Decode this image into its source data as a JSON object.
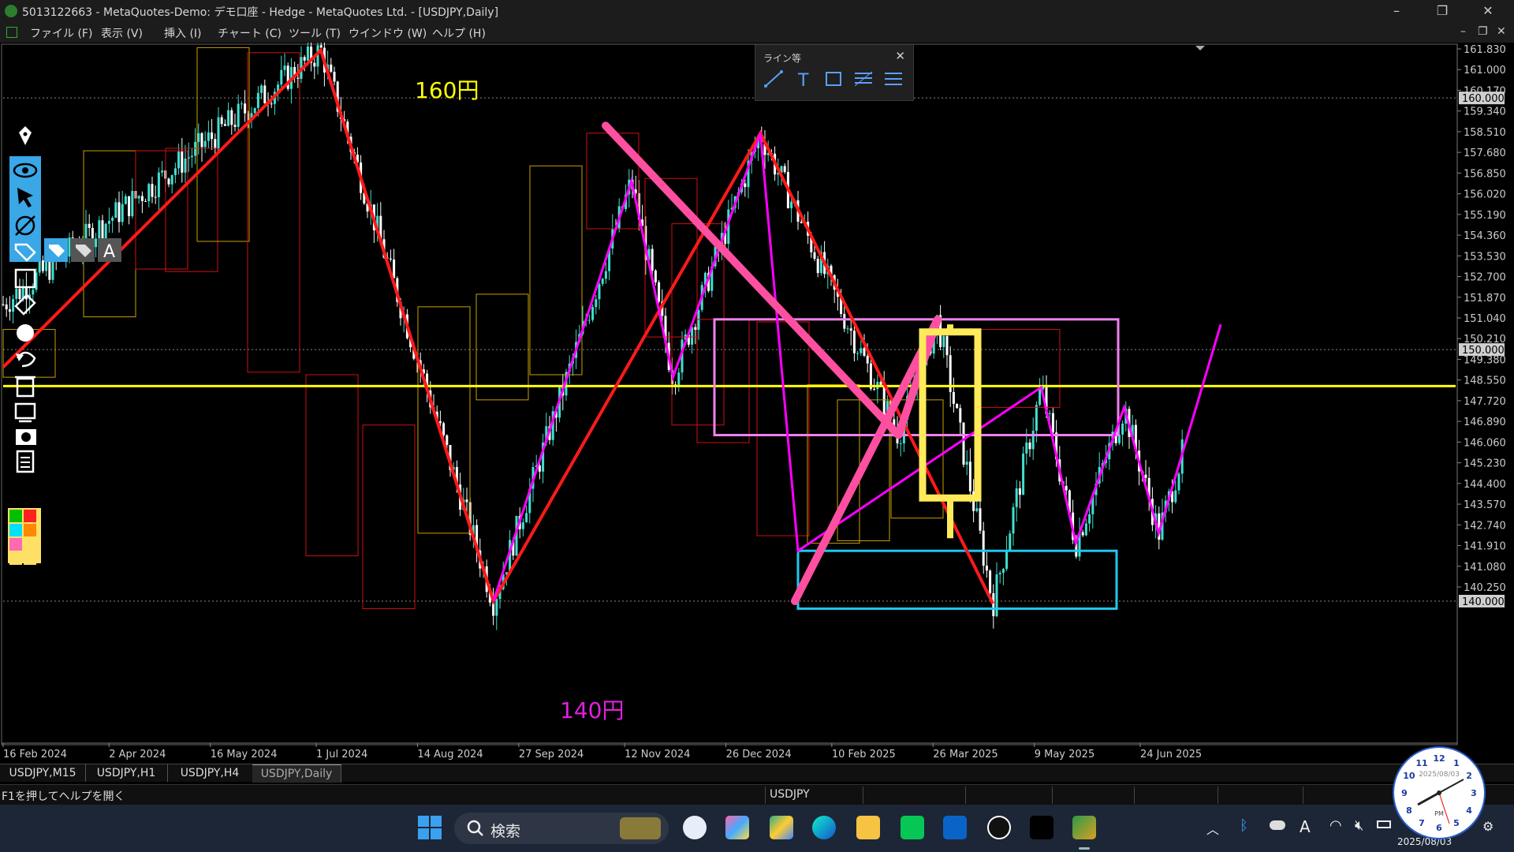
{
  "window": {
    "title": "5013122663 - MetaQuotes-Demo: デモ口座 - Hedge - MetaQuotes Ltd. - [USDJPY,Daily]",
    "controls": [
      "–",
      "❐",
      "✕"
    ]
  },
  "menu": {
    "items": [
      "ファイル (F)",
      "表示 (V)",
      "挿入 (I)",
      "チャート (C)",
      "ツール (T)",
      "ウインドウ (W)",
      "ヘルプ (H)"
    ]
  },
  "line_toolbar": {
    "title": "ライン等",
    "close": "✕",
    "tools": [
      "trendline-icon",
      "text-icon",
      "rectangle-icon",
      "fibonacci-icon",
      "channel-icon"
    ]
  },
  "left_tools": [
    "pen-icon",
    "eye-icon",
    "cursor-icon",
    "eraser-icon",
    "tag-icon",
    "square-icon",
    "ruler-icon",
    "dot-icon",
    "undo-icon",
    "trash-icon",
    "monitor-icon",
    "camera-icon",
    "notes-icon"
  ],
  "left_tools_sub": {
    "text_tool": "A"
  },
  "palette": [
    "#00c000",
    "#ff2020",
    "#00e0ff",
    "#ff8800",
    "#ff69b4",
    "#ffe066"
  ],
  "chart": {
    "symbol": "USDJPY",
    "timeframe": "Daily",
    "annotations": {
      "top_label": "160円",
      "bottom_label": "140円"
    },
    "colors": {
      "background": "#000000",
      "up_candle": "#40e0d0",
      "down_candle": "#ffffff",
      "h_line": "#ffff00",
      "zigzag_red": "#ff1a1a",
      "zigzag_magenta": "#ff00ff",
      "pink_line": "#ff4fa0",
      "yellow_box": "#ffeb5a",
      "blue_box": "#1ec8f0",
      "violet_box": "#ee82ee"
    },
    "price_ticks": [
      "161.830",
      "161.000",
      "160.170",
      "159.340",
      "158.510",
      "157.680",
      "156.850",
      "156.020",
      "155.190",
      "154.360",
      "153.530",
      "152.700",
      "151.870",
      "151.040",
      "150.210",
      "149.380",
      "148.550",
      "147.720",
      "146.890",
      "146.060",
      "145.230",
      "144.400",
      "143.570",
      "142.740",
      "141.910",
      "141.080",
      "140.250"
    ],
    "price_ticks_range": [
      140.25,
      161.83
    ],
    "highlight_labels": [
      "160.000",
      "150.000",
      "140.000"
    ],
    "date_ticks": [
      "16 Feb 2024",
      "2 Apr 2024",
      "16 May 2024",
      "1 Jul 2024",
      "14 Aug 2024",
      "27 Sep 2024",
      "12 Nov 2024",
      "26 Dec 2024",
      "10 Feb 2025",
      "26 Mar 2025",
      "9 May 2025",
      "24 Jun 2025"
    ]
  },
  "chart_data": {
    "type": "candlestick",
    "symbol": "USDJPY",
    "timeframe": "Daily",
    "x": [
      "2024-02-16",
      "2024-04-02",
      "2024-05-16",
      "2024-07-01",
      "2024-08-14",
      "2024-09-27",
      "2024-11-12",
      "2024-12-26",
      "2025-02-10",
      "2025-03-26",
      "2025-05-09",
      "2025-06-24"
    ],
    "y_range": [
      140.0,
      162.2
    ],
    "horizontal_lines": [
      160.0,
      150.0,
      148.55,
      140.0
    ],
    "swing_points": [
      {
        "date": "2024-02-16",
        "price": 151.8
      },
      {
        "date": "2024-07-03",
        "price": 161.9
      },
      {
        "date": "2024-09-16",
        "price": 140.0
      },
      {
        "date": "2024-11-15",
        "price": 156.7
      },
      {
        "date": "2024-12-03",
        "price": 148.9
      },
      {
        "date": "2025-01-10",
        "price": 158.6
      },
      {
        "date": "2025-03-11",
        "price": 146.6
      },
      {
        "date": "2025-03-28",
        "price": 151.2
      },
      {
        "date": "2025-04-21",
        "price": 139.9
      },
      {
        "date": "2025-05-12",
        "price": 148.5
      },
      {
        "date": "2025-05-27",
        "price": 142.3
      },
      {
        "date": "2025-06-17",
        "price": 147.7
      },
      {
        "date": "2025-07-02",
        "price": 142.7
      },
      {
        "date": "2025-07-29",
        "price": 151.0
      }
    ]
  },
  "tabs": [
    "USDJPY,M15",
    "USDJPY,H1",
    "USDJPY,H4",
    "USDJPY,Daily"
  ],
  "active_tab": "USDJPY,Daily",
  "status": {
    "help_text": "F1を押してヘルプを開く",
    "symbol": "USDJPY"
  },
  "taskbar": {
    "search_placeholder": "検索",
    "apps": [
      "windows-start-icon",
      "clock-app-icon",
      "copilot-icon",
      "photos-icon",
      "edge-icon",
      "explorer-icon",
      "line-icon",
      "outlook-icon",
      "tradingview-icon",
      "xm-icon",
      "metatrader-icon"
    ],
    "tray": [
      "chevron-up-icon",
      "bluetooth-icon",
      "cloud-icon",
      "ime-icon",
      "wifi-icon",
      "mute-icon",
      "battery-icon",
      "notification-icon"
    ],
    "ime": "A",
    "date": "2025/08/03",
    "clock_label": "2025/08/03"
  }
}
